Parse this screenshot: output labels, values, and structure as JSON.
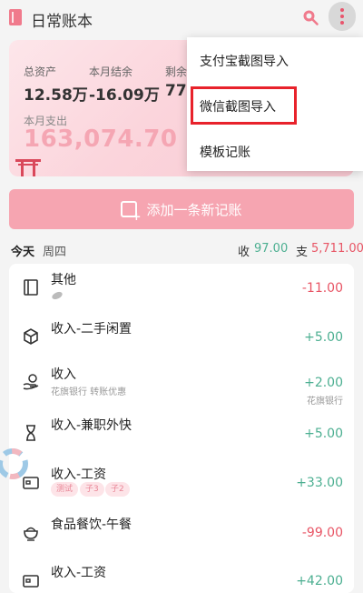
{
  "header": {
    "title": "日常账本",
    "icons": {
      "book": "book-icon",
      "search": "search-icon",
      "more": "more-vertical-icon"
    }
  },
  "summary": {
    "assets_label": "总资产",
    "assets_value": "12.58万",
    "month_balance_label": "本月结余",
    "month_balance_value": "-16.09万",
    "remaining_label": "剩余",
    "remaining_value": "77(",
    "month_expense_label": "本月支出",
    "month_expense_value": "163,074.70"
  },
  "add_button": {
    "label": "添加一条新记账"
  },
  "day": {
    "today": "今天",
    "weekday": "周四",
    "income_label": "收",
    "income_value": "97.00",
    "expense_label": "支",
    "expense_value": "5,711.00"
  },
  "records": [
    {
      "title": "其他",
      "amount": "-11.00",
      "type": "neg",
      "icon": "book-icon"
    },
    {
      "title": "收入-二手闲置",
      "amount": "+5.00",
      "type": "pos",
      "icon": "box-icon"
    },
    {
      "title": "收入",
      "subtitle": "花旗银行 转账优惠",
      "amount": "+2.00",
      "account": "花旗银行",
      "type": "pos",
      "icon": "hand-coin-icon"
    },
    {
      "title": "收入-兼职外快",
      "amount": "+5.00",
      "type": "pos",
      "icon": "hourglass-icon"
    },
    {
      "title": "收入-工资",
      "tags": [
        "测试",
        "子3",
        "子2"
      ],
      "amount": "+33.00",
      "type": "pos",
      "icon": "wallet-icon"
    },
    {
      "title": "食品餐饮-午餐",
      "amount": "-99.00",
      "type": "neg",
      "icon": "bowl-icon"
    },
    {
      "title": "收入-工资",
      "amount": "+42.00",
      "type": "pos",
      "icon": "wallet-icon"
    }
  ],
  "menu": {
    "items": [
      "支付宝截图导入",
      "微信截图导入",
      "模板记账"
    ],
    "highlighted": "微信截图导入"
  },
  "colors": {
    "accent": "#f07a8c",
    "add_button": "#f6a5b1",
    "income": "#4caf91",
    "expense": "#e85565",
    "highlight": "#e8222b"
  }
}
